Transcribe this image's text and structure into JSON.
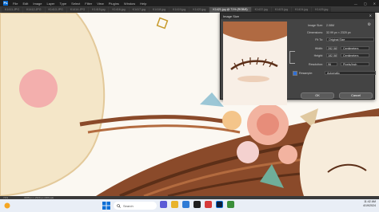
{
  "app": {
    "logo_text": "Ps"
  },
  "menu": [
    "File",
    "Edit",
    "Image",
    "Layer",
    "Type",
    "Select",
    "Filter",
    "View",
    "Plugins",
    "Window",
    "Help"
  ],
  "window_controls": [
    "—",
    "▢",
    "✕"
  ],
  "tabs": [
    {
      "label": "K1411.JPG",
      "active": false
    },
    {
      "label": "K1412.JPG",
      "active": false
    },
    {
      "label": "K1413.JPG",
      "active": false
    },
    {
      "label": "K1414.JPG",
      "active": false
    },
    {
      "label": "K1415.jpg",
      "active": false
    },
    {
      "label": "K1416.jpg",
      "active": false
    },
    {
      "label": "K1417.jpg",
      "active": false
    },
    {
      "label": "K1418.jpg",
      "active": false
    },
    {
      "label": "K1419.jpg",
      "active": false
    },
    {
      "label": "K1420.jpg",
      "active": false
    },
    {
      "label": "K1421.jpg @ 71% (RGB/8)",
      "active": true
    },
    {
      "label": "K1422.jpg",
      "active": false
    },
    {
      "label": "K1423.jpg",
      "active": false
    },
    {
      "label": "K1424.jpg",
      "active": false
    },
    {
      "label": "K1425.jpg",
      "active": false
    }
  ],
  "status": {
    "zoom": "71%",
    "doc_info": "3268 px x 2320 px (300 ppi)"
  },
  "dialog": {
    "title": "Image Size",
    "image_size_label": "Image Size:",
    "image_size_value": "2.08M",
    "dimensions_label": "Dimensions:",
    "dimensions_value": "32.99 px × 2320 px",
    "fit_to_label": "Fit To:",
    "fit_to_value": "Original Size",
    "width_label": "Width:",
    "width_value": "282.58",
    "width_unit": "Centimeters",
    "height_label": "Height:",
    "height_value": "182.58",
    "height_unit": "Centimeters",
    "resolution_label": "Resolution:",
    "resolution_value": "96",
    "resolution_unit": "Pixels/Inch",
    "resample_label": "Resample:",
    "resample_value": "Automatic",
    "ok_label": "OK",
    "cancel_label": "Cancel"
  },
  "taskbar": {
    "search_placeholder": "Search",
    "temp": "27°C",
    "time": "11:42 AM",
    "date": "4/19/2024"
  },
  "colors": {
    "ps_blue": "#0b6fd6",
    "dialog_bg": "#444444",
    "taskbar_bg": "#e9eef6"
  }
}
